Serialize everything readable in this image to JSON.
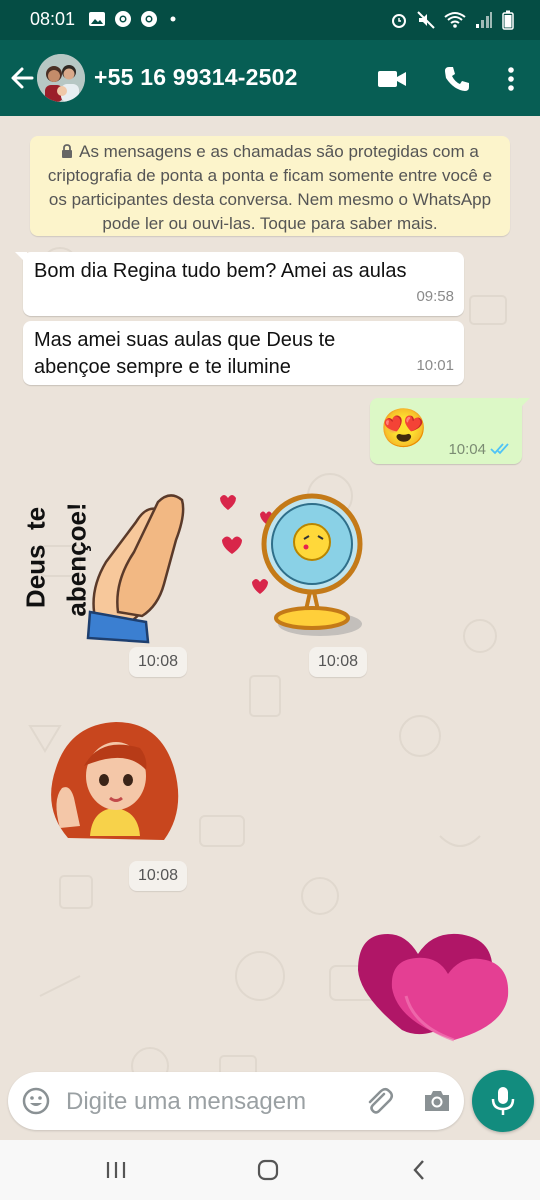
{
  "status": {
    "time": "08:01",
    "icons_left": [
      "image-icon",
      "chrome-icon",
      "chrome-icon",
      "dot-icon"
    ],
    "icons_right": [
      "alarm-icon",
      "mute-icon",
      "wifi-icon",
      "signal-icon",
      "battery-icon"
    ]
  },
  "header": {
    "title": "+55 16 99314-2502",
    "icons": [
      "back-arrow-icon",
      "avatar",
      "video-call-icon",
      "voice-call-icon",
      "more-options-icon"
    ]
  },
  "chat": {
    "notice": "As mensagens e as chamadas são protegidas com a criptografia de ponta a ponta e ficam somente entre você e os participantes desta conversa. Nem mesmo o WhatsApp pode ler ou ouvi-las. Toque para saber mais.",
    "messages": [
      {
        "direction": "in",
        "text": "Bom dia Regina tudo bem? Amei as aulas",
        "time": "09:58"
      },
      {
        "direction": "in",
        "text": "Mas amei suas aulas que Deus te abençoe sempre e te ilumine",
        "time": "10:01"
      },
      {
        "direction": "out",
        "emoji": "😍",
        "time": "10:04",
        "status": "read"
      }
    ],
    "stickers": [
      {
        "name": "praying-hands-sticker",
        "caption_line1": "Deus  te",
        "caption_line2": "abençoe!",
        "time": "10:08"
      },
      {
        "name": "fan-kiss-sticker",
        "time": "10:08"
      },
      {
        "name": "waving-girl-sticker",
        "time": "10:08"
      },
      {
        "name": "fluffy-hearts-sticker"
      }
    ],
    "read_tick_color": "#4fc3f7"
  },
  "composer": {
    "placeholder": "Digite uma mensagem"
  },
  "colors": {
    "status_bar": "#054d44",
    "app_bar": "#075e54",
    "accent": "#128c7e",
    "bubble_out": "#dcf8c6",
    "notice_bg": "#fcf4cb"
  }
}
